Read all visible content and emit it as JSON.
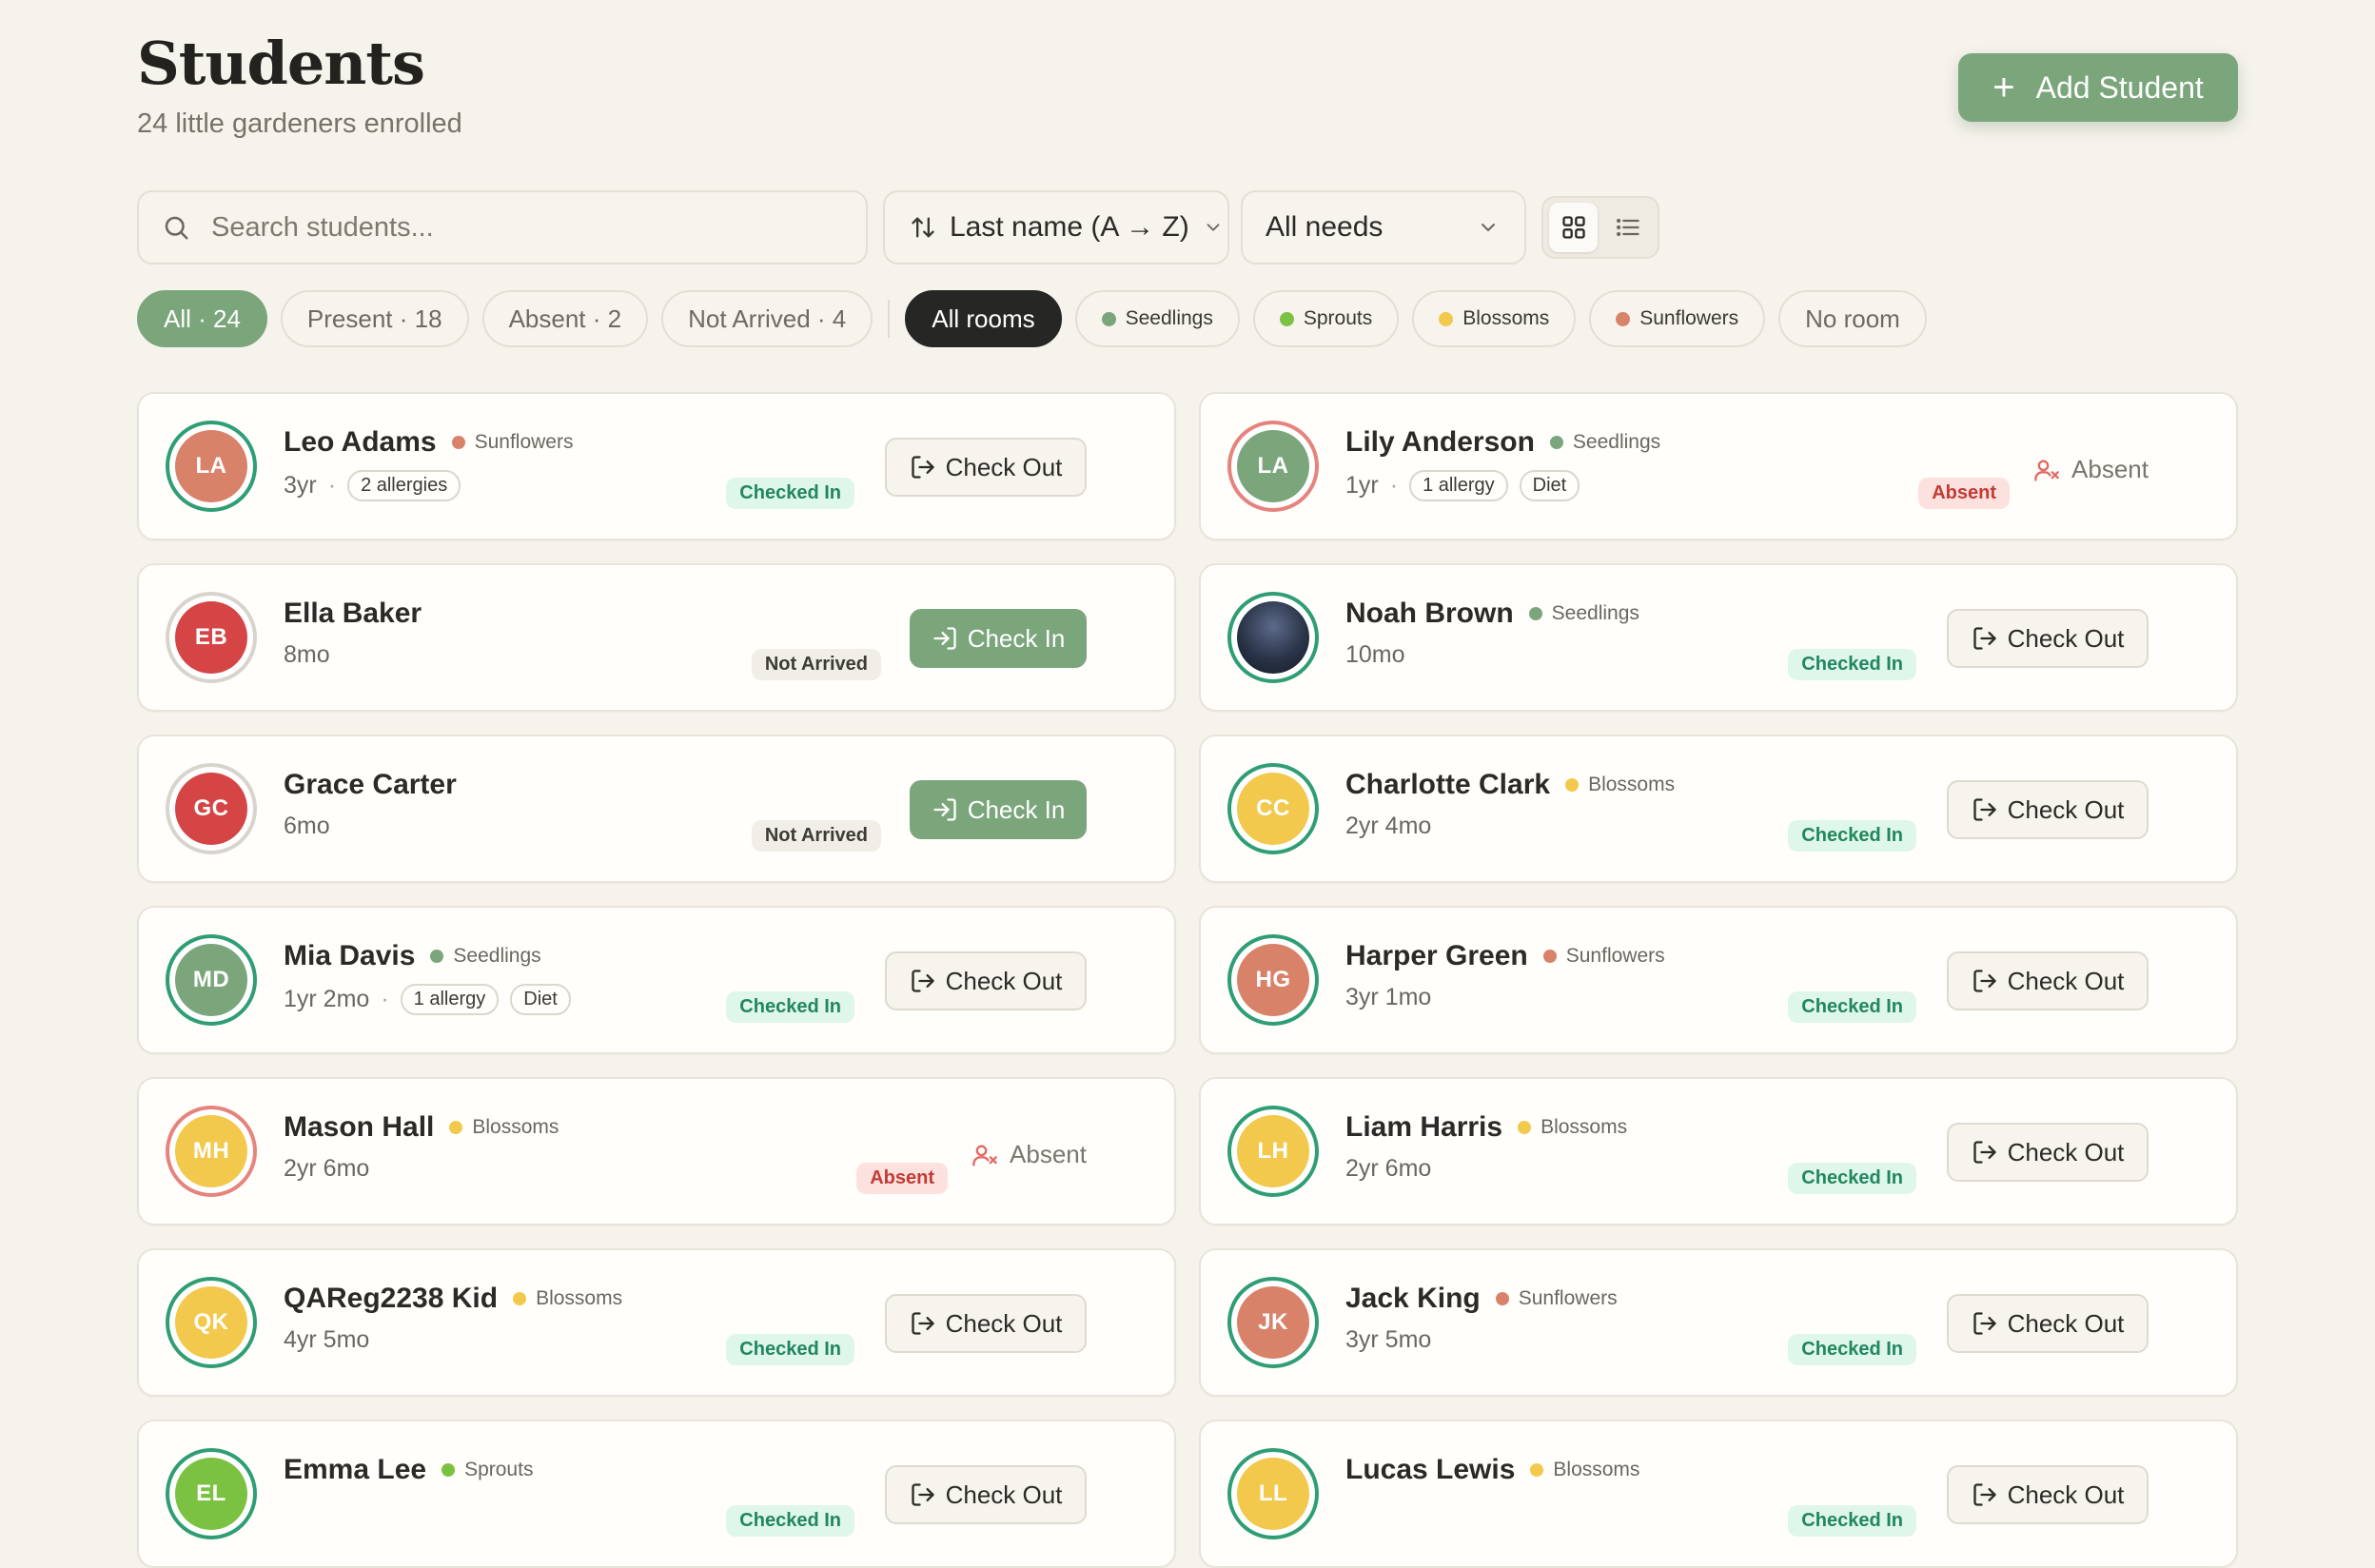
{
  "header": {
    "title": "Students",
    "subtitle": "24 little gardeners enrolled",
    "add_label": "Add Student",
    "add_icon": "plus-icon"
  },
  "toolbar": {
    "search_placeholder": "Search students...",
    "sort_label": "Last name (A → Z)",
    "needs_label": "All needs"
  },
  "filters": {
    "all": "All · 24",
    "present": "Present · 18",
    "absent": "Absent · 2",
    "not_arrived": "Not Arrived · 4",
    "all_rooms": "All rooms",
    "seedlings": "Seedlings",
    "sprouts": "Sprouts",
    "blossoms": "Blossoms",
    "sunflowers": "Sunflowers",
    "no_room": "No room"
  },
  "colors": {
    "accent": "#7ba67c",
    "present_ring": "#2f9e74",
    "absent_ring": "#e6837d",
    "not_arrived_ring": "#d8d4cc",
    "seedlings": "#7ba67c",
    "sprouts": "#7cc242",
    "blossoms": "#f2c94c",
    "sunflowers": "#d9826a"
  },
  "students": [
    {
      "initials": "LA",
      "name": "Leo Adams",
      "room": "Sunflowers",
      "room_color": "#d9826a",
      "avatar_color": "#d9826a",
      "age": "3yr",
      "tags": [
        "2 allergies"
      ],
      "status": "Checked In",
      "state": "in",
      "action": "Check Out"
    },
    {
      "initials": "LA",
      "name": "Lily Anderson",
      "room": "Seedlings",
      "room_color": "#7ba67c",
      "avatar_color": "#7ba67c",
      "age": "1yr",
      "tags": [
        "1 allergy",
        "Diet"
      ],
      "status": "Absent",
      "state": "ab",
      "action": "Absent"
    },
    {
      "initials": "EB",
      "name": "Ella Baker",
      "room": "",
      "room_color": "",
      "avatar_color": "#d64545",
      "age": "8mo",
      "tags": [],
      "status": "Not Arrived",
      "state": "na",
      "action": "Check In"
    },
    {
      "initials": "",
      "name": "Noah Brown",
      "room": "Seedlings",
      "room_color": "#7ba67c",
      "avatar_color": "#2a3448",
      "avatar_photo": true,
      "age": "10mo",
      "tags": [],
      "status": "Checked In",
      "state": "in",
      "action": "Check Out"
    },
    {
      "initials": "GC",
      "name": "Grace Carter",
      "room": "",
      "room_color": "",
      "avatar_color": "#d64545",
      "age": "6mo",
      "tags": [],
      "status": "Not Arrived",
      "state": "na",
      "action": "Check In"
    },
    {
      "initials": "CC",
      "name": "Charlotte Clark",
      "room": "Blossoms",
      "room_color": "#f2c94c",
      "avatar_color": "#f2c94c",
      "age": "2yr 4mo",
      "tags": [],
      "status": "Checked In",
      "state": "in",
      "action": "Check Out"
    },
    {
      "initials": "MD",
      "name": "Mia Davis",
      "room": "Seedlings",
      "room_color": "#7ba67c",
      "avatar_color": "#7ba67c",
      "age": "1yr 2mo",
      "tags": [
        "1 allergy",
        "Diet"
      ],
      "status": "Checked In",
      "state": "in",
      "action": "Check Out"
    },
    {
      "initials": "HG",
      "name": "Harper Green",
      "room": "Sunflowers",
      "room_color": "#d9826a",
      "avatar_color": "#d9826a",
      "age": "3yr 1mo",
      "tags": [],
      "status": "Checked In",
      "state": "in",
      "action": "Check Out"
    },
    {
      "initials": "MH",
      "name": "Mason Hall",
      "room": "Blossoms",
      "room_color": "#f2c94c",
      "avatar_color": "#f2c94c",
      "age": "2yr 6mo",
      "tags": [],
      "status": "Absent",
      "state": "ab",
      "action": "Absent"
    },
    {
      "initials": "LH",
      "name": "Liam Harris",
      "room": "Blossoms",
      "room_color": "#f2c94c",
      "avatar_color": "#f2c94c",
      "age": "2yr 6mo",
      "tags": [],
      "status": "Checked In",
      "state": "in",
      "action": "Check Out"
    },
    {
      "initials": "QK",
      "name": "QAReg2238 Kid",
      "room": "Blossoms",
      "room_color": "#f2c94c",
      "avatar_color": "#f2c94c",
      "age": "4yr 5mo",
      "tags": [],
      "status": "Checked In",
      "state": "in",
      "action": "Check Out"
    },
    {
      "initials": "JK",
      "name": "Jack King",
      "room": "Sunflowers",
      "room_color": "#d9826a",
      "avatar_color": "#d9826a",
      "age": "3yr 5mo",
      "tags": [],
      "status": "Checked In",
      "state": "in",
      "action": "Check Out"
    },
    {
      "initials": "EL",
      "name": "Emma Lee",
      "room": "Sprouts",
      "room_color": "#7cc242",
      "avatar_color": "#7cc242",
      "age": "",
      "tags": [],
      "status": "Checked In",
      "state": "in",
      "action": "Check Out"
    },
    {
      "initials": "LL",
      "name": "Lucas Lewis",
      "room": "Blossoms",
      "room_color": "#f2c94c",
      "avatar_color": "#f2c94c",
      "age": "",
      "tags": [],
      "status": "Checked In",
      "state": "in",
      "action": "Check Out"
    }
  ]
}
